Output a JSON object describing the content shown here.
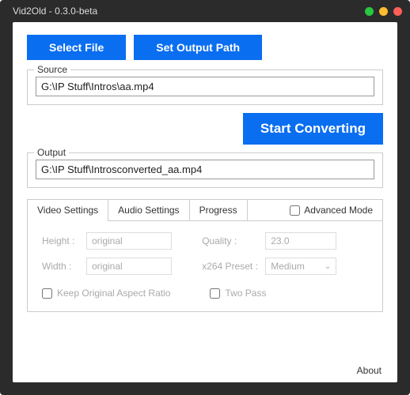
{
  "window": {
    "title": "Vid2Old - 0.3.0-beta"
  },
  "buttons": {
    "select_file": "Select File",
    "set_output": "Set Output Path",
    "convert": "Start Converting"
  },
  "source": {
    "label": "Source",
    "value": "G:\\IP Stuff\\Intros\\aa.mp4"
  },
  "output": {
    "label": "Output",
    "value": "G:\\IP Stuff\\Introsconverted_aa.mp4"
  },
  "tabs": {
    "video": "Video Settings",
    "audio": "Audio Settings",
    "progress": "Progress"
  },
  "advanced": {
    "label": "Advanced Mode"
  },
  "settings": {
    "height_label": "Height :",
    "height_value": "original",
    "width_label": "Width :",
    "width_value": "original",
    "quality_label": "Quality :",
    "quality_value": "23.0",
    "preset_label": "x264 Preset :",
    "preset_value": "Medium",
    "keep_ar": "Keep Original Aspect Ratio",
    "two_pass": "Two Pass"
  },
  "footer": {
    "about": "About"
  }
}
